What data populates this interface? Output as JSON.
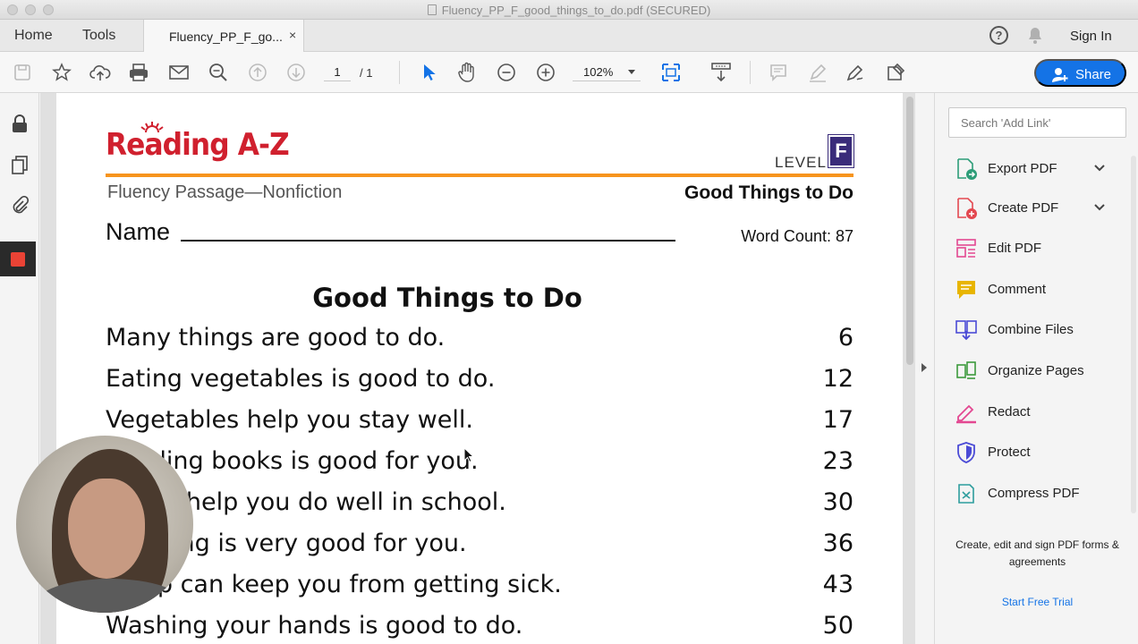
{
  "window": {
    "title": "Fluency_PP_F_good_things_to_do.pdf (SECURED)"
  },
  "nav": {
    "home": "Home",
    "tools": "Tools",
    "tab_label": "Fluency_PP_F_go...",
    "tab_close": "×",
    "help": "?",
    "sign_in": "Sign In"
  },
  "toolbar": {
    "page_current": "1",
    "page_total": "/ 1",
    "zoom": "102%",
    "share": "Share"
  },
  "document": {
    "logo": "Reading A-Z",
    "level_label": "LEVEL",
    "level": "F",
    "subhead": "Fluency Passage—Nonfiction",
    "header_title": "Good Things to Do",
    "name_label": "Name",
    "word_count": "Word Count: 87",
    "title": "Good Things to Do",
    "lines": [
      {
        "text": "Many things are good to do.",
        "count": "6"
      },
      {
        "text": "Eating vegetables is good to do.",
        "count": "12"
      },
      {
        "text": "Vegetables help you stay well.",
        "count": "17"
      },
      {
        "text": "Reading books is good for you.",
        "count": "23"
      },
      {
        "text": "Books help you do well in school.",
        "count": "30"
      },
      {
        "text": "Sleeping is very good for you.",
        "count": "36"
      },
      {
        "text": "Sleep can keep you from getting sick.",
        "count": "43"
      },
      {
        "text": "Washing your hands is good to do.",
        "count": "50"
      }
    ]
  },
  "right_panel": {
    "search_placeholder": "Search 'Add Link'",
    "tools": [
      {
        "label": "Export PDF",
        "icon": "export-pdf-icon",
        "color": "#2d9d78"
      },
      {
        "label": "Create PDF",
        "icon": "create-pdf-icon",
        "color": "#e34850"
      },
      {
        "label": "Edit PDF",
        "icon": "edit-pdf-icon",
        "color": "#e34891"
      },
      {
        "label": "Comment",
        "icon": "comment-icon",
        "color": "#e8b500"
      },
      {
        "label": "Combine Files",
        "icon": "combine-files-icon",
        "color": "#4b4bd6"
      },
      {
        "label": "Organize Pages",
        "icon": "organize-pages-icon",
        "color": "#3c9a3c"
      },
      {
        "label": "Redact",
        "icon": "redact-icon",
        "color": "#e34891"
      },
      {
        "label": "Protect",
        "icon": "protect-icon",
        "color": "#4b4bd6"
      },
      {
        "label": "Compress PDF",
        "icon": "compress-pdf-icon",
        "color": "#2d9d9d"
      }
    ],
    "promo": "Create, edit and sign PDF forms & agreements",
    "trial": "Start Free Trial"
  },
  "colors": {
    "brand_red": "#d0202e",
    "accent_orange": "#f7941d",
    "level_purple": "#3a2c7a",
    "share_blue": "#1473e6"
  }
}
